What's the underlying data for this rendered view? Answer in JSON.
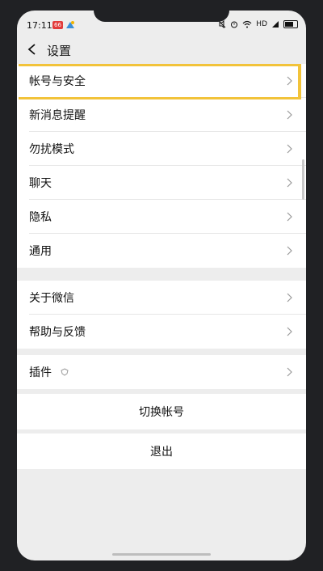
{
  "status": {
    "time": "17:11",
    "badge": "66",
    "network": "HD"
  },
  "nav": {
    "title": "设置"
  },
  "group1": [
    {
      "label": "帐号与安全"
    },
    {
      "label": "新消息提醒"
    },
    {
      "label": "勿扰模式"
    },
    {
      "label": "聊天"
    },
    {
      "label": "隐私"
    },
    {
      "label": "通用"
    }
  ],
  "group2": [
    {
      "label": "关于微信"
    },
    {
      "label": "帮助与反馈"
    }
  ],
  "group3": [
    {
      "label": "插件"
    }
  ],
  "actions": {
    "switch_account": "切换帐号",
    "logout": "退出"
  },
  "colors": {
    "highlight": "#f2c33a",
    "background": "#ededed"
  }
}
